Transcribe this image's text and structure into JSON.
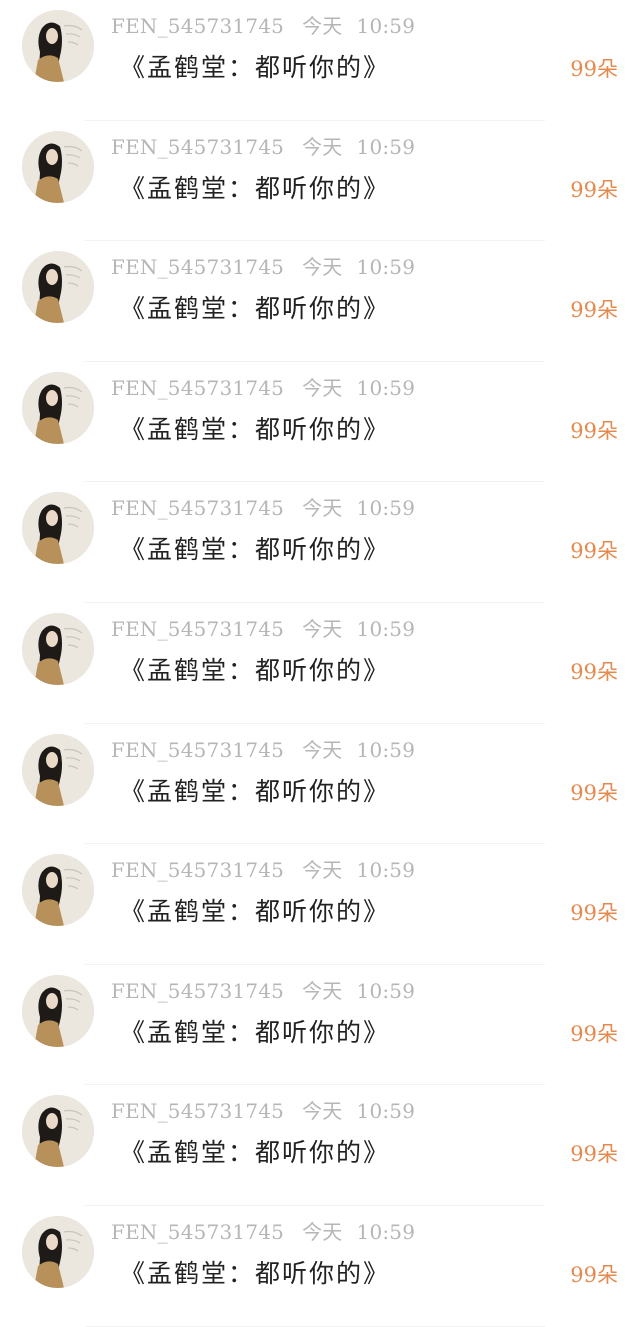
{
  "accent_color": "#e58a4e",
  "comments": [
    {
      "user": "FEN_545731745",
      "day": "今天",
      "time": "10:59",
      "message": "《孟鹤堂：都听你的》",
      "gift": "99朵"
    },
    {
      "user": "FEN_545731745",
      "day": "今天",
      "time": "10:59",
      "message": "《孟鹤堂：都听你的》",
      "gift": "99朵"
    },
    {
      "user": "FEN_545731745",
      "day": "今天",
      "time": "10:59",
      "message": "《孟鹤堂：都听你的》",
      "gift": "99朵"
    },
    {
      "user": "FEN_545731745",
      "day": "今天",
      "time": "10:59",
      "message": "《孟鹤堂：都听你的》",
      "gift": "99朵"
    },
    {
      "user": "FEN_545731745",
      "day": "今天",
      "time": "10:59",
      "message": "《孟鹤堂：都听你的》",
      "gift": "99朵"
    },
    {
      "user": "FEN_545731745",
      "day": "今天",
      "time": "10:59",
      "message": "《孟鹤堂：都听你的》",
      "gift": "99朵"
    },
    {
      "user": "FEN_545731745",
      "day": "今天",
      "time": "10:59",
      "message": "《孟鹤堂：都听你的》",
      "gift": "99朵"
    },
    {
      "user": "FEN_545731745",
      "day": "今天",
      "time": "10:59",
      "message": "《孟鹤堂：都听你的》",
      "gift": "99朵"
    },
    {
      "user": "FEN_545731745",
      "day": "今天",
      "time": "10:59",
      "message": "《孟鹤堂：都听你的》",
      "gift": "99朵"
    },
    {
      "user": "FEN_545731745",
      "day": "今天",
      "time": "10:59",
      "message": "《孟鹤堂：都听你的》",
      "gift": "99朵"
    },
    {
      "user": "FEN_545731745",
      "day": "今天",
      "time": "10:59",
      "message": "《孟鹤堂：都听你的》",
      "gift": "99朵"
    }
  ]
}
